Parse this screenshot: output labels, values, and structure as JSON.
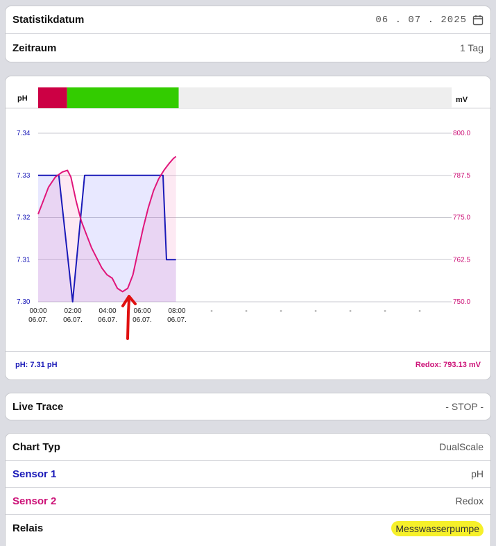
{
  "date_card": {
    "label": "Statistikdatum",
    "value": "06 . 07 . 2025",
    "icon": "calendar-icon",
    "period_label": "Zeitraum",
    "period_value": "1 Tag"
  },
  "chart_data": {
    "type": "line",
    "left_axis_label": "pH",
    "right_axis_label": "mV",
    "top_bar": {
      "segments": [
        {
          "color": "#cc0044",
          "from": 0.0,
          "to": 0.07
        },
        {
          "color": "#33cc00",
          "from": 0.07,
          "to": 0.34
        },
        {
          "color": "#eeeeee",
          "from": 0.34,
          "to": 1.0
        }
      ]
    },
    "x_ticks": [
      {
        "time": "00:00",
        "date": "06.07."
      },
      {
        "time": "02:00",
        "date": "06.07."
      },
      {
        "time": "04:00",
        "date": "06.07."
      },
      {
        "time": "06:00",
        "date": "06.07."
      },
      {
        "time": "08:00",
        "date": "06.07."
      },
      {
        "time": "-",
        "date": ""
      },
      {
        "time": "-",
        "date": ""
      },
      {
        "time": "-",
        "date": ""
      },
      {
        "time": "-",
        "date": ""
      },
      {
        "time": "-",
        "date": ""
      },
      {
        "time": "-",
        "date": ""
      },
      {
        "time": "-",
        "date": ""
      }
    ],
    "x_range_hours": [
      0,
      24
    ],
    "y_left": {
      "min": 7.3,
      "max": 7.34,
      "ticks": [
        "7.34",
        "7.33",
        "7.32",
        "7.31",
        "7.30"
      ]
    },
    "y_right": {
      "min": 750.0,
      "max": 800.0,
      "ticks": [
        "800.0",
        "787.5",
        "775.0",
        "762.5",
        "750.0"
      ]
    },
    "grid": true,
    "series": [
      {
        "name": "pH",
        "axis": "left",
        "color": "#1a1ab8",
        "fill": "rgba(110,110,255,0.16)",
        "points": [
          [
            0,
            7.33
          ],
          [
            1.2,
            7.33
          ],
          [
            2.0,
            7.3
          ],
          [
            2.7,
            7.33
          ],
          [
            7.25,
            7.33
          ],
          [
            7.45,
            7.31
          ],
          [
            8.0,
            7.31
          ]
        ]
      },
      {
        "name": "Redox",
        "axis": "right",
        "color": "#e0157a",
        "fill": "rgba(240,120,180,0.16)",
        "points": [
          [
            0,
            776
          ],
          [
            0.3,
            780
          ],
          [
            0.6,
            784
          ],
          [
            1.0,
            787
          ],
          [
            1.4,
            788.5
          ],
          [
            1.7,
            789
          ],
          [
            1.9,
            787
          ],
          [
            2.2,
            780
          ],
          [
            2.5,
            774
          ],
          [
            2.8,
            770
          ],
          [
            3.1,
            766
          ],
          [
            3.4,
            763
          ],
          [
            3.7,
            760
          ],
          [
            4.0,
            758
          ],
          [
            4.3,
            757
          ],
          [
            4.6,
            754
          ],
          [
            4.9,
            753
          ],
          [
            5.2,
            754
          ],
          [
            5.5,
            758
          ],
          [
            5.8,
            765
          ],
          [
            6.1,
            772
          ],
          [
            6.4,
            778
          ],
          [
            6.7,
            783
          ],
          [
            7.0,
            786.5
          ],
          [
            7.3,
            789
          ],
          [
            7.6,
            791
          ],
          [
            7.85,
            792.5
          ],
          [
            8.0,
            793.1
          ]
        ]
      }
    ],
    "footer_left": "pH: 7.31 pH",
    "footer_right": "Redox: 793.13 mV"
  },
  "live_card": {
    "label": "Live Trace",
    "value": "- STOP -"
  },
  "settings": {
    "chart_type_label": "Chart Typ",
    "chart_type_value": "DualScale",
    "sensor1_label": "Sensor 1",
    "sensor1_value": "pH",
    "sensor2_label": "Sensor 2",
    "sensor2_value": "Redox",
    "relais_label": "Relais",
    "relais_value": "Messwasserpumpe"
  }
}
